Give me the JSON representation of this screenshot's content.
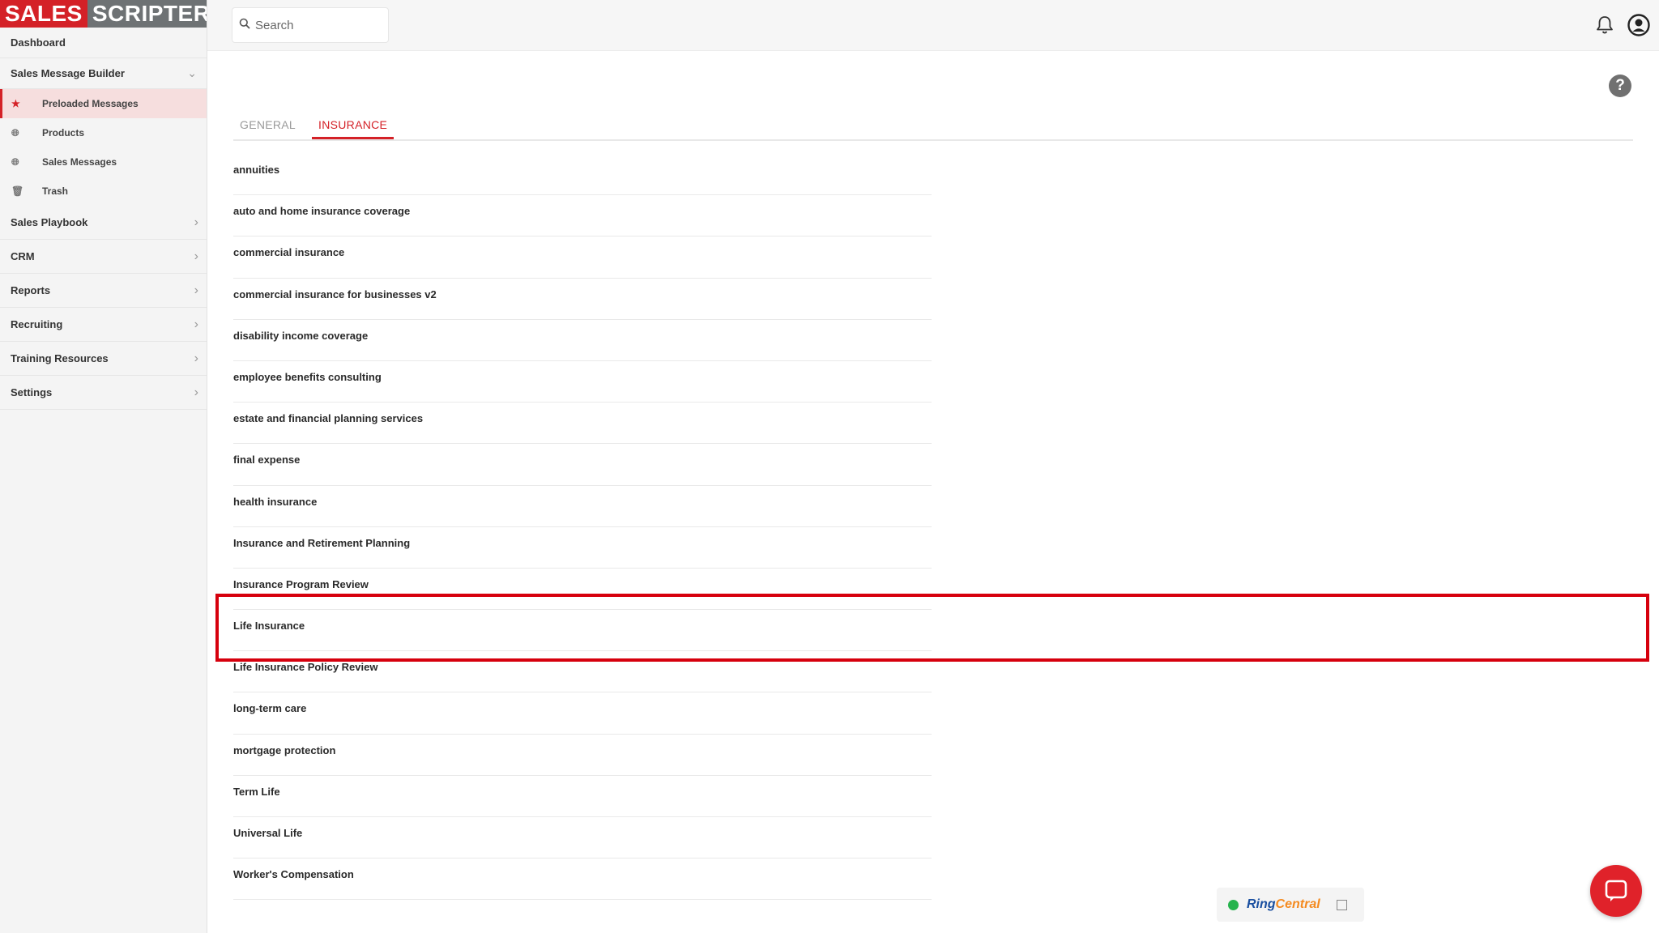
{
  "logo": {
    "part1": "SALES",
    "part2": "SCRIPTER"
  },
  "sidebar": {
    "dashboard": "Dashboard",
    "message_builder": {
      "label": "Sales Message Builder",
      "items": [
        {
          "label": "Preloaded Messages",
          "icon": "star-icon"
        },
        {
          "label": "Products",
          "icon": "globe-icon"
        },
        {
          "label": "Sales Messages",
          "icon": "globe-icon"
        },
        {
          "label": "Trash",
          "icon": "trash-icon"
        }
      ]
    },
    "groups": [
      {
        "label": "Sales Playbook"
      },
      {
        "label": "CRM"
      },
      {
        "label": "Reports"
      },
      {
        "label": "Recruiting"
      },
      {
        "label": "Training Resources"
      },
      {
        "label": "Settings"
      }
    ]
  },
  "search": {
    "placeholder": "Search"
  },
  "tabs": [
    {
      "label": "GENERAL"
    },
    {
      "label": "INSURANCE"
    }
  ],
  "list": [
    "annuities",
    "auto and home insurance coverage",
    "commercial insurance",
    "commercial insurance for businesses v2",
    "disability income coverage",
    "employee benefits consulting",
    "estate and financial planning services",
    "final expense",
    "health insurance",
    "Insurance and Retirement Planning",
    "Insurance Program Review",
    "Life Insurance",
    "Life Insurance Policy Review",
    "long-term care",
    "mortgage protection",
    "Term Life",
    "Universal Life",
    "Worker's Compensation"
  ],
  "ringcentral": {
    "brand_a": "Ring",
    "brand_b": "Central"
  },
  "colors": {
    "accent": "#d42127",
    "highlight_border": "#d6000d"
  }
}
